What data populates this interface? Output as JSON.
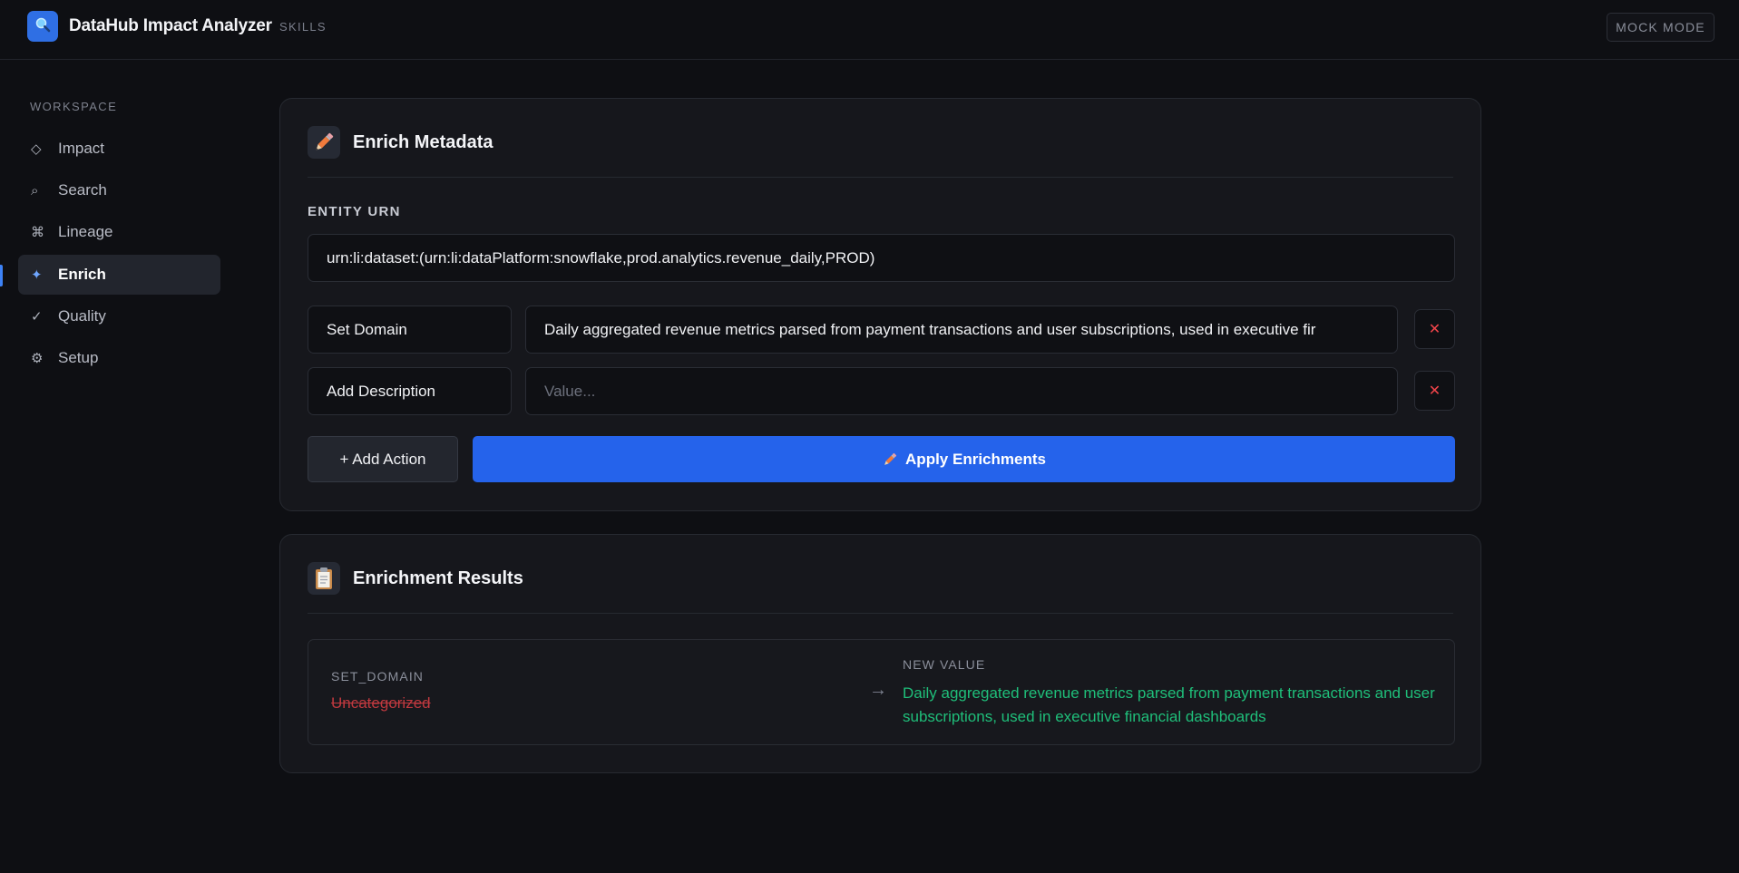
{
  "header": {
    "app_title": "DataHub Impact Analyzer",
    "tag": "SKILLS",
    "mode_label": "MOCK MODE",
    "logo_icon": "magnifier-icon"
  },
  "sidebar": {
    "section_label": "WORKSPACE",
    "items": [
      {
        "label": "Impact",
        "icon": "diamond-icon",
        "glyph": "◇",
        "active": false
      },
      {
        "label": "Search",
        "icon": "search-icon",
        "glyph": "⌕",
        "active": false
      },
      {
        "label": "Lineage",
        "icon": "command-icon",
        "glyph": "⌘",
        "active": false
      },
      {
        "label": "Enrich",
        "icon": "sparkle-icon",
        "glyph": "✦",
        "active": true
      },
      {
        "label": "Quality",
        "icon": "check-icon",
        "glyph": "✓",
        "active": false
      },
      {
        "label": "Setup",
        "icon": "gear-icon",
        "glyph": "⚙",
        "active": false
      }
    ]
  },
  "enrich": {
    "title": "Enrich Metadata",
    "icon": "pencil-icon",
    "entity_urn_label": "ENTITY URN",
    "entity_urn_value": "urn:li:dataset:(urn:li:dataPlatform:snowflake,prod.analytics.revenue_daily,PROD)",
    "actions": [
      {
        "type": "Set Domain",
        "value": "Daily aggregated revenue metrics parsed from payment transactions and user subscriptions, used in executive fir",
        "placeholder": "Value...",
        "remove_glyph": "✕"
      },
      {
        "type": "Add Description",
        "value": "",
        "placeholder": "Value...",
        "remove_glyph": "✕"
      }
    ],
    "add_action_label": "+ Add Action",
    "apply_label": "Apply Enrichments"
  },
  "results": {
    "title": "Enrichment Results",
    "icon": "clipboard-icon",
    "rows": [
      {
        "action": "SET_DOMAIN",
        "old_value": "Uncategorized",
        "arrow": "→",
        "new_label": "NEW VALUE",
        "new_value": "Daily aggregated revenue metrics parsed from payment transactions and user subscriptions, used in executive financial dashboards"
      }
    ]
  },
  "colors": {
    "accent": "#2563eb",
    "success": "#1fbf7a",
    "danger": "#f0444a",
    "background": "#0e0f13",
    "card": "#16171c"
  }
}
